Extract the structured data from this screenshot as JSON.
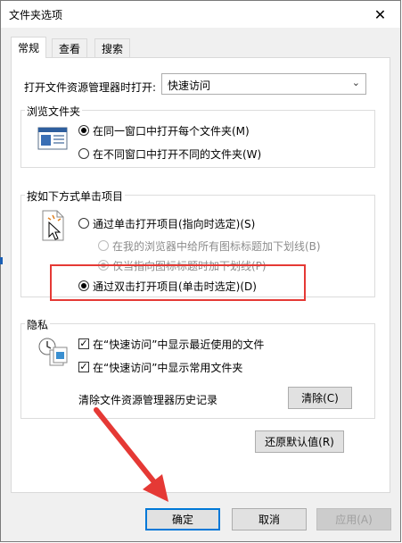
{
  "window": {
    "title": "文件夹选项",
    "close_glyph": "✕"
  },
  "tabs": [
    {
      "label": "常规"
    },
    {
      "label": "查看"
    },
    {
      "label": "搜索"
    }
  ],
  "open_explorer": {
    "label": "打开文件资源管理器时打开:",
    "value": "快速访问"
  },
  "browse": {
    "title": "浏览文件夹",
    "same_window": "在同一窗口中打开每个文件夹(M)",
    "new_window": "在不同窗口中打开不同的文件夹(W)"
  },
  "click": {
    "title": "按如下方式单击项目",
    "single": "通过单击打开项目(指向时选定)(S)",
    "underline_all": "在我的浏览器中给所有图标标题加下划线(B)",
    "underline_hover": "仅当指向图标标题时加下划线(P)",
    "double": "通过双击打开项目(单击时选定)(D)"
  },
  "privacy": {
    "title": "隐私",
    "recent_files": "在“快速访问”中显示最近使用的文件",
    "frequent_folders": "在“快速访问”中显示常用文件夹",
    "clear_label": "清除文件资源管理器历史记录",
    "clear_button": "清除(C)",
    "check_glyph": "✓"
  },
  "restore_button": "还原默认值(R)",
  "footer": {
    "ok": "确定",
    "cancel": "取消",
    "apply": "应用(A)"
  },
  "colors": {
    "accent": "#0078d7",
    "annotation": "#e53935"
  }
}
